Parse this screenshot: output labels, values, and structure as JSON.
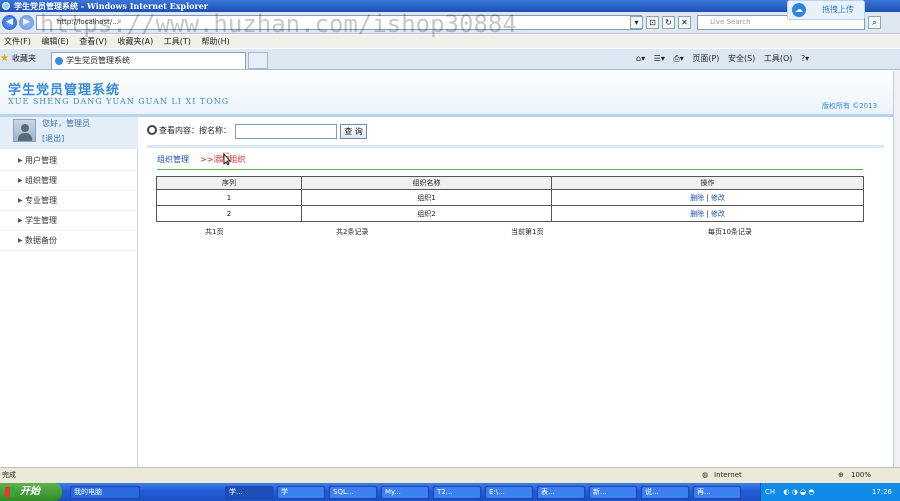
{
  "browser": {
    "title": "学生党员管理系统 - Windows Internet Explorer",
    "address": "http://localhost/...",
    "search_placeholder": "Live Search",
    "cloud_button": "拖拽上传",
    "menu": [
      "文件(F)",
      "编辑(E)",
      "查看(V)",
      "收藏夹(A)",
      "工具(T)",
      "帮助(H)"
    ],
    "favorites_label": "收藏夹",
    "tab_title": "学生党员管理系统",
    "commands": [
      "页面(P)",
      "安全(S)",
      "工具(O)"
    ],
    "status_left": "完成",
    "status_zone": "Internet",
    "zoom": "100%"
  },
  "watermark": "https://www.huzhan.com/ishop30884",
  "site": {
    "system_name": "学生党员管理系统",
    "pinyin": "XUE SHENG DANG YUAN GUAN LI XI TONG",
    "copyright": "版权所有 ©2013"
  },
  "user": {
    "greeting": "您好，管理员",
    "logout": "[退出]"
  },
  "nav": [
    "用户管理",
    "组织管理",
    "专业管理",
    "学生管理",
    "数据备份"
  ],
  "search": {
    "label": "查看内容：",
    "field_label": "按名称：",
    "value": "",
    "button": "查 询"
  },
  "crumbs": {
    "current": "组织管理",
    "add_link": ">>添加组织"
  },
  "table": {
    "headers": [
      "序列",
      "组织名称",
      "操作"
    ],
    "rows": [
      {
        "seq": "1",
        "name": "组织1",
        "delete": "删除",
        "sep": "|",
        "edit": "修改"
      },
      {
        "seq": "2",
        "name": "组织2",
        "delete": "删除",
        "sep": "|",
        "edit": "修改"
      }
    ]
  },
  "pager": {
    "pages": "共1页",
    "records": "共2条记录",
    "current": "当前第1页",
    "per_page": "每页10条记录"
  },
  "taskbar": {
    "start": "开始",
    "my_computer": "我的电脑",
    "tasks": [
      "学...",
      "学",
      "SQL...",
      "My...",
      "T2...",
      "E:\\...",
      "表...",
      "新...",
      "说...",
      "再..."
    ],
    "clock": "17:26",
    "ime": "CH"
  }
}
